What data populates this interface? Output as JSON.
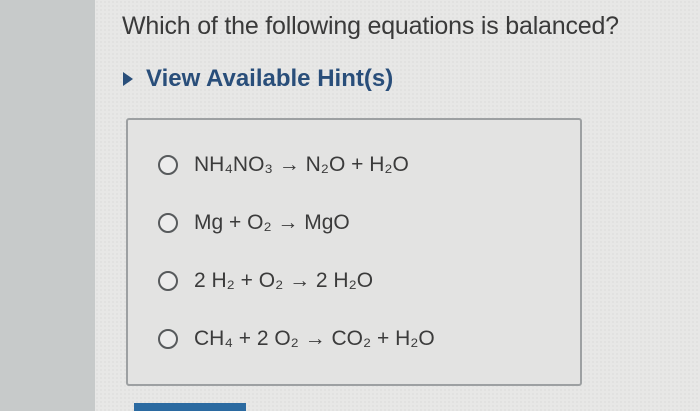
{
  "question": {
    "text": "Which of the following equations is balanced?"
  },
  "hint": {
    "label": "View Available Hint(s)",
    "icon": "caret-right-icon",
    "color": "#294e7a"
  },
  "options": [
    {
      "label": "NH₄NO₃ → N₂O + H₂O"
    },
    {
      "label": "Mg + O₂ → MgO"
    },
    {
      "label": "2 H₂ + O₂ → 2 H₂O"
    },
    {
      "label": "CH₄ + 2 O₂ → CO₂ + H₂O"
    }
  ],
  "submit_button": {
    "color": "#2b6aa1"
  }
}
